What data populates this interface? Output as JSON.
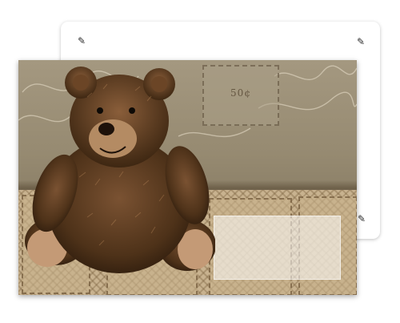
{
  "back_card": {
    "corner_icons": [
      "cross-pen-icon",
      "cross-pen-icon",
      "cross-pen-icon"
    ]
  },
  "front_card": {
    "stamp_value_text": "50¢",
    "label_placeholder": ""
  },
  "colors": {
    "card_bg": "#968a71",
    "stamp_bg": "#c8b28f",
    "bear_fur": "#5a3a1e",
    "bear_muzzle": "#b48b63"
  }
}
